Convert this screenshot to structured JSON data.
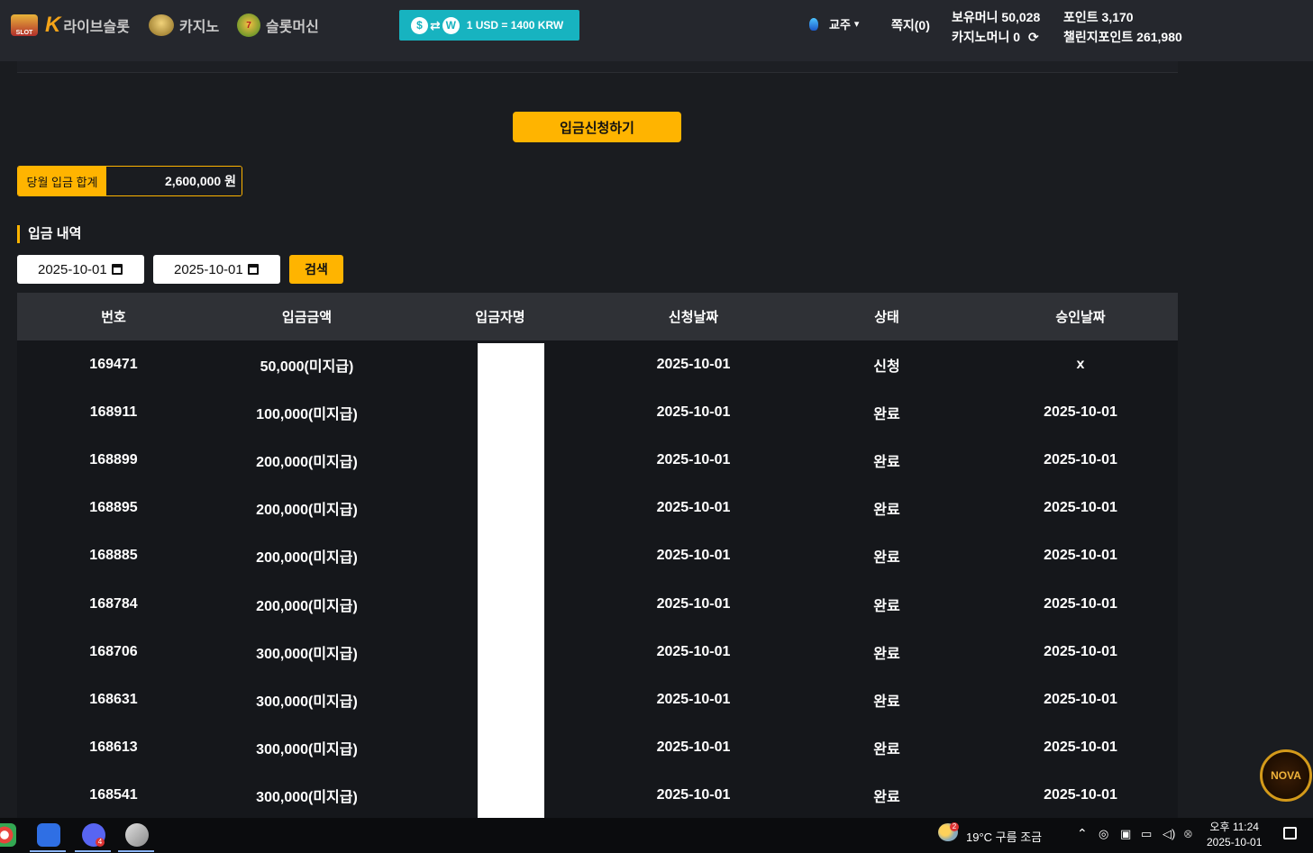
{
  "header": {
    "nav": [
      {
        "label": "라이브슬롯",
        "icon": "k-logo-icon"
      },
      {
        "label": "카지노",
        "icon": "casino-icon"
      },
      {
        "label": "슬롯머신",
        "icon": "slot-machine-icon"
      }
    ],
    "slot_logo_text": "SLOT",
    "rate_text": "1 USD = 1400 KRW",
    "rate_from_symbol": "$",
    "rate_to_symbol": "W",
    "language": "교주",
    "messages": "쪽지(0)",
    "balance_money": "보유머니 50,028",
    "casino_money": "카지노머니 0",
    "points": "포인트 3,170",
    "challenge_points": "챌린지포인트 261,980"
  },
  "main": {
    "deposit_request_button": "입금신청하기",
    "monthly_total_label": "당월 입금 합계",
    "monthly_total_value": "2,600,000 원",
    "section_title": "입금 내역",
    "date_from": "2025-10-01",
    "date_to": "2025-10-01",
    "search_button": "검색"
  },
  "table": {
    "headers": [
      "번호",
      "입금금액",
      "입금자명",
      "신청날짜",
      "상태",
      "승인날짜"
    ],
    "rows": [
      {
        "no": "169471",
        "amount": "50,000(미지급)",
        "name": "",
        "request_date": "2025-10-01",
        "status": "신청",
        "approved_date": "x"
      },
      {
        "no": "168911",
        "amount": "100,000(미지급)",
        "name": "",
        "request_date": "2025-10-01",
        "status": "완료",
        "approved_date": "2025-10-01"
      },
      {
        "no": "168899",
        "amount": "200,000(미지급)",
        "name": "",
        "request_date": "2025-10-01",
        "status": "완료",
        "approved_date": "2025-10-01"
      },
      {
        "no": "168895",
        "amount": "200,000(미지급)",
        "name": "",
        "request_date": "2025-10-01",
        "status": "완료",
        "approved_date": "2025-10-01"
      },
      {
        "no": "168885",
        "amount": "200,000(미지급)",
        "name": "",
        "request_date": "2025-10-01",
        "status": "완료",
        "approved_date": "2025-10-01"
      },
      {
        "no": "168784",
        "amount": "200,000(미지급)",
        "name": "",
        "request_date": "2025-10-01",
        "status": "완료",
        "approved_date": "2025-10-01"
      },
      {
        "no": "168706",
        "amount": "300,000(미지급)",
        "name": "",
        "request_date": "2025-10-01",
        "status": "완료",
        "approved_date": "2025-10-01"
      },
      {
        "no": "168631",
        "amount": "300,000(미지급)",
        "name": "",
        "request_date": "2025-10-01",
        "status": "완료",
        "approved_date": "2025-10-01"
      },
      {
        "no": "168613",
        "amount": "300,000(미지급)",
        "name": "",
        "request_date": "2025-10-01",
        "status": "완료",
        "approved_date": "2025-10-01"
      },
      {
        "no": "168541",
        "amount": "300,000(미지급)",
        "name": "",
        "request_date": "2025-10-01",
        "status": "완료",
        "approved_date": "2025-10-01"
      }
    ]
  },
  "floating_logo_text": "NOVA",
  "taskbar": {
    "weather_badge": "2",
    "weather": "19°C  구름 조금",
    "time": "오후 11:24",
    "date": "2025-10-01",
    "notify_badge": "4"
  },
  "colors": {
    "accent": "#ffb400",
    "background": "#1a1c20",
    "header": "#25272d",
    "rate_box": "#17b3c0"
  }
}
